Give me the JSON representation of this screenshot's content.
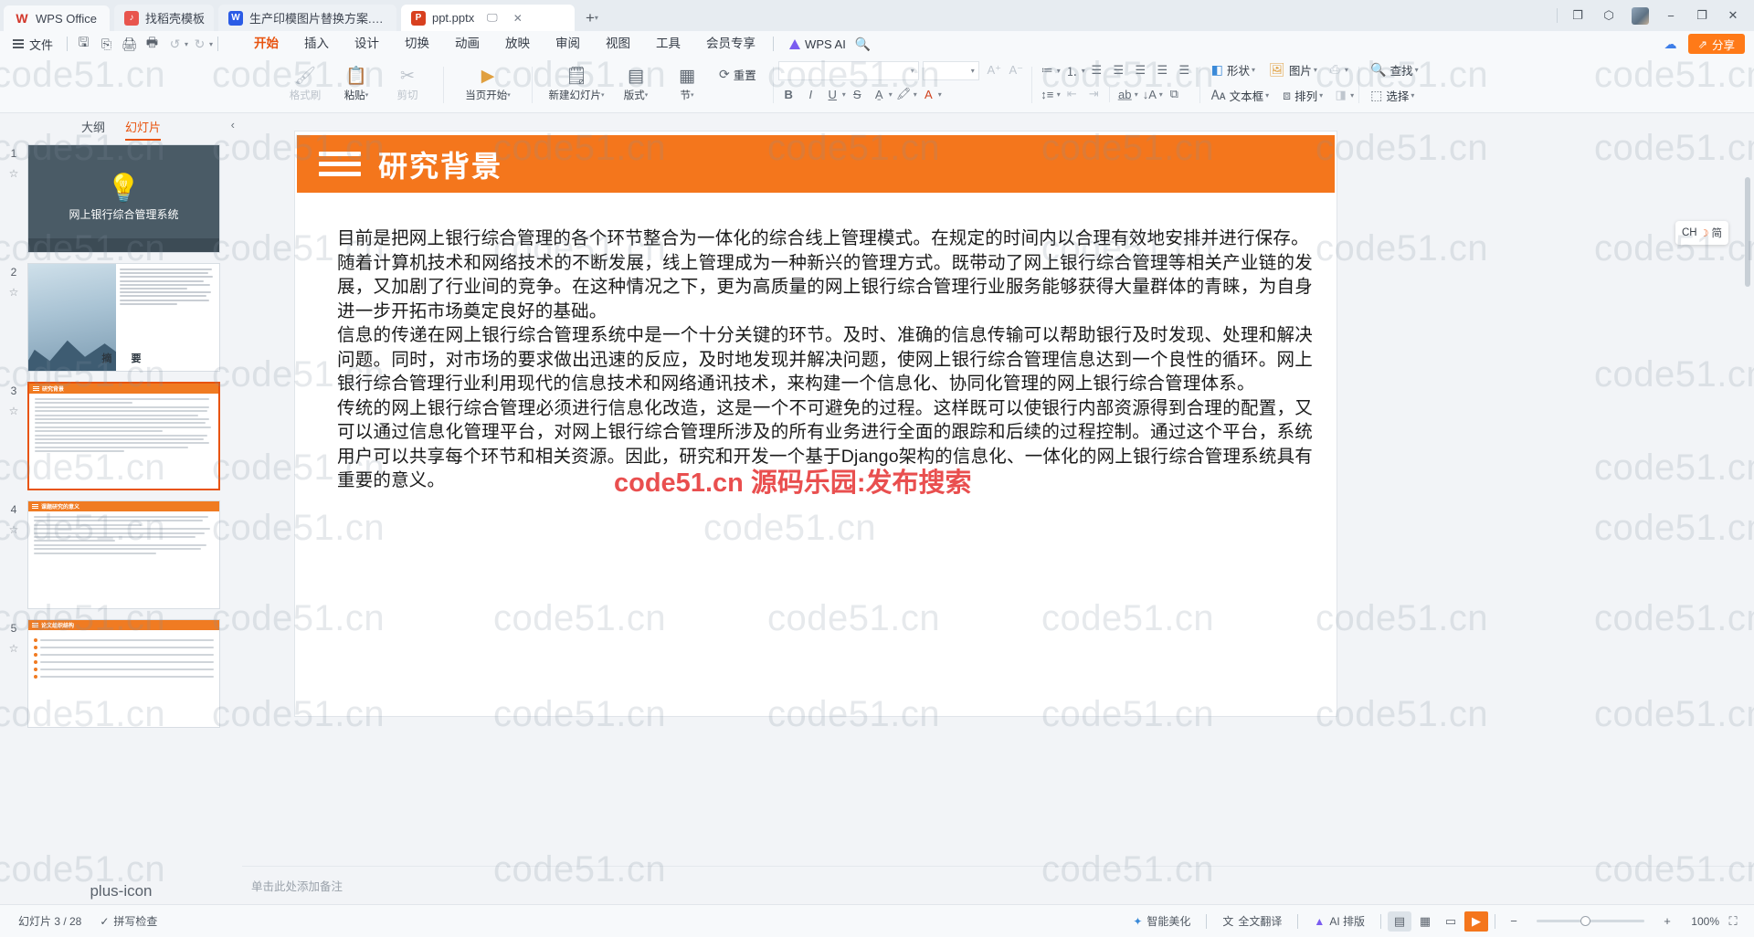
{
  "titlebar": {
    "app_name": "WPS Office",
    "app_icon": "wps-logo-icon",
    "tabs": [
      {
        "label": "找稻壳模板",
        "icon": "template-icon",
        "active": false
      },
      {
        "label": "生产印模图片替换方案.docx",
        "icon": "word-doc-icon",
        "active": false
      },
      {
        "label": "ppt.pptx",
        "icon": "powerpoint-icon",
        "active": true
      }
    ],
    "newtab_label": "+",
    "window_buttons": {
      "minimize": "−",
      "maximize": "❐",
      "close": "✕"
    }
  },
  "menubar": {
    "file_label": "文件",
    "quick_icons": [
      "save-icon",
      "save-as-cloud-icon",
      "print-icon",
      "print-preview-icon",
      "undo-icon",
      "redo-icon"
    ],
    "ribbon_tabs": [
      {
        "label": "开始",
        "active": true
      },
      {
        "label": "插入",
        "active": false
      },
      {
        "label": "设计",
        "active": false
      },
      {
        "label": "切换",
        "active": false
      },
      {
        "label": "动画",
        "active": false
      },
      {
        "label": "放映",
        "active": false
      },
      {
        "label": "审阅",
        "active": false
      },
      {
        "label": "视图",
        "active": false
      },
      {
        "label": "工具",
        "active": false
      },
      {
        "label": "会员专享",
        "active": false
      }
    ],
    "wps_ai_label": "WPS AI",
    "search_icon": "search-icon",
    "share_label": "分享",
    "cloud_icon": "cloud-sync-icon"
  },
  "ribbon": {
    "groups": [
      {
        "label": "格式刷",
        "icon": "format-painter-icon",
        "dim": true
      },
      {
        "label": "粘贴",
        "icon": "paste-icon",
        "dropdown": true
      },
      {
        "label": "剪切",
        "icon": "cut-icon",
        "dim": true
      },
      {
        "label": "当页开始",
        "icon": "play-from-current-icon",
        "dropdown": true
      },
      {
        "label": "新建幻灯片",
        "icon": "new-slide-icon",
        "dropdown": true
      },
      {
        "label": "版式",
        "icon": "layout-icon",
        "dropdown": true
      },
      {
        "label": "节",
        "icon": "section-icon",
        "dropdown": true
      }
    ],
    "reset_label": "重置",
    "font_name": "",
    "font_size": "",
    "font_tools": [
      "bold-B",
      "italic-I",
      "underline-U",
      "strikethrough-S",
      "char-spacing-icon",
      "text-highlight-icon",
      "font-color-icon"
    ],
    "para_tools": [
      "bullet-list-icon",
      "numbered-list-icon",
      "align-left-icon",
      "align-center-icon",
      "align-right-icon",
      "justify-icon",
      "line-spacing-icon",
      "decrease-indent-icon",
      "increase-indent-icon",
      "text-direction-icon",
      "align-text-icon",
      "convert-to-smartart-icon"
    ],
    "right_buttons": [
      {
        "label": "形状",
        "icon": "shapes-icon"
      },
      {
        "label": "图片",
        "icon": "picture-icon"
      },
      {
        "label": "查找",
        "icon": "search-icon"
      },
      {
        "label": "文本框",
        "icon": "textbox-icon"
      },
      {
        "label": "排列",
        "icon": "arrange-icon"
      },
      {
        "label": "选择",
        "icon": "select-icon"
      }
    ]
  },
  "leftpane": {
    "tab_outline": "大纲",
    "tab_slides": "幻灯片",
    "collapse_icon": "chevron-left-icon",
    "add_slide_icon": "plus-icon",
    "slides": [
      {
        "number": "1",
        "type": "title",
        "title": "网上银行综合管理系统",
        "selected": false
      },
      {
        "number": "2",
        "type": "image-text",
        "title": "摘　要",
        "selected": false
      },
      {
        "number": "3",
        "type": "doc",
        "title": "研究背景",
        "selected": true
      },
      {
        "number": "4",
        "type": "doc",
        "title": "课题研究的意义",
        "selected": false
      },
      {
        "number": "5",
        "type": "numbered",
        "title": "论文组织结构",
        "selected": false
      }
    ]
  },
  "slide": {
    "title": "研究背景",
    "title_bg": "#f4761c",
    "paragraphs": [
      "目前是把网上银行综合管理的各个环节整合为一体化的综合线上管理模式。在规定的时间内以合理有效地安排并进行保存。",
      "随着计算机技术和网络技术的不断发展，线上管理成为一种新兴的管理方式。既带动了网上银行综合管理等相关产业链的发展，又加剧了行业间的竞争。在这种情况之下，更为高质量的网上银行综合管理行业服务能够获得大量群体的青睐，为自身进一步开拓市场奠定良好的基础。",
      "信息的传递在网上银行综合管理系统中是一个十分关键的环节。及时、准确的信息传输可以帮助银行及时发现、处理和解决问题。同时，对市场的要求做出迅速的反应，及时地发现并解决问题，使网上银行综合管理信息达到一个良性的循环。网上银行综合管理行业利用现代的信息技术和网络通讯技术，来构建一个信息化、协同化管理的网上银行综合管理体系。",
      "传统的网上银行综合管理必须进行信息化改造，这是一个不可避免的过程。这样既可以使银行内部资源得到合理的配置，又可以通过信息化管理平台，对网上银行综合管理所涉及的所有业务进行全面的跟踪和后续的过程控制。通过这个平台，系统用户可以共享每个环节和相关资源。因此，研究和开发一个基于Django架构的信息化、一体化的网上银行综合管理系统具有重要的意义。"
    ]
  },
  "ime": {
    "lang": "CH",
    "mode_icon": "moon-icon",
    "mode": "简"
  },
  "notes": {
    "placeholder": "单击此处添加备注"
  },
  "status": {
    "slide_count": "幻灯片 3 / 28",
    "spellcheck": "拼写检查",
    "smart_typeset": "智能美化",
    "translate": "全文翻译",
    "ai_assist": "AI 排版",
    "views": [
      "normal-view-icon",
      "sorter-view-icon",
      "reading-view-icon",
      "slideshow-icon"
    ],
    "zoom_value": "100%",
    "fit_icon": "fit-to-window-icon"
  },
  "watermarks": {
    "text": "code51.cn",
    "red_text": "code51.cn 源码乐园:发布搜索"
  }
}
